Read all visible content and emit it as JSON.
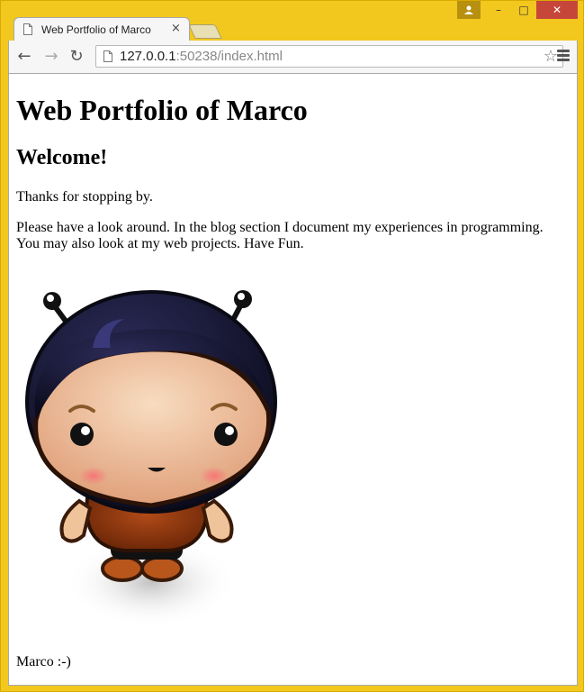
{
  "browser": {
    "tab_title": "Web Portfolio of Marco",
    "tab_close": "×",
    "url_host": "127.0.0.1",
    "url_rest": ":50238/index.html",
    "star": "☆",
    "back": "←",
    "forward": "→",
    "reload": "↻",
    "window_controls": {
      "minimize": "–",
      "maximize": "□",
      "close": "✕"
    }
  },
  "page": {
    "title": "Web Portfolio of Marco",
    "heading": "Welcome!",
    "intro": "Thanks for stopping by.",
    "body": "Please have a look around. In the blog section I document my experiences in programming. You may also look at my web projects. Have Fun.",
    "signature": "Marco :-)"
  },
  "colors": {
    "window_frame": "#f2c81e",
    "close_button": "#c7463a"
  }
}
